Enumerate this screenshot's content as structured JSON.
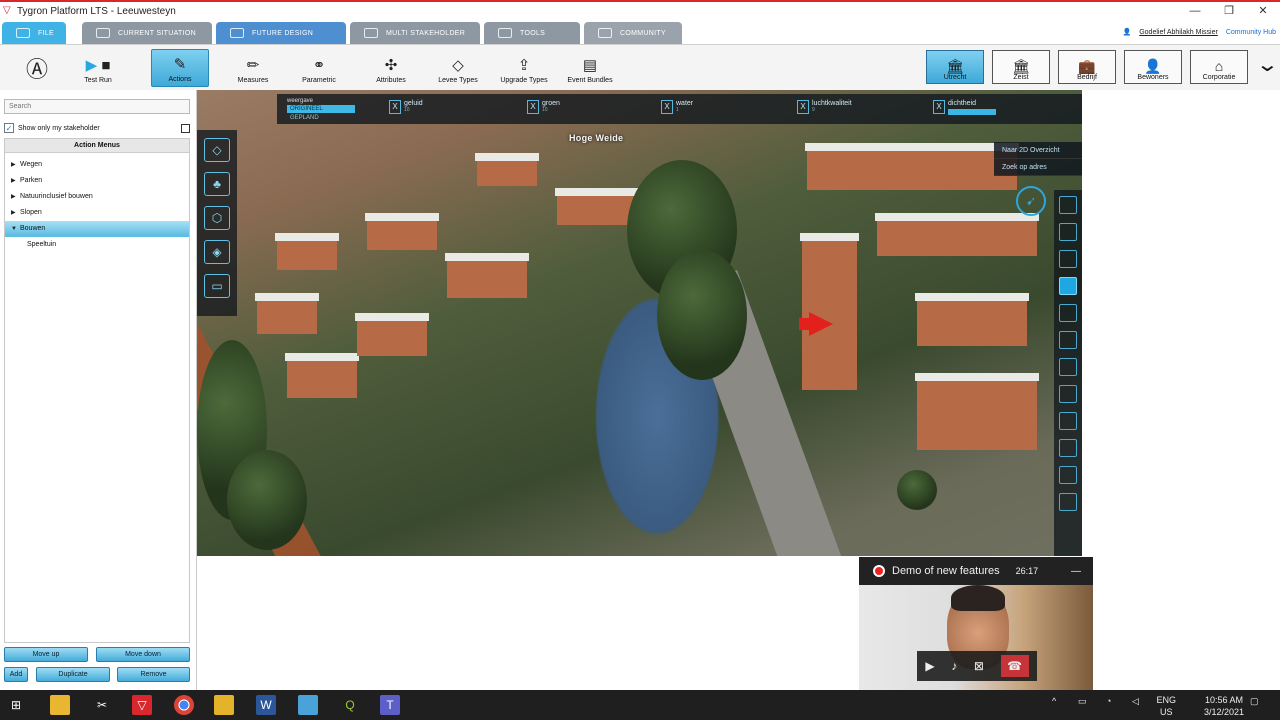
{
  "window": {
    "title": "Tygron Platform LTS - Leeuwesteyn"
  },
  "tabs": [
    {
      "label": "FILE",
      "color": "#40b3e6"
    },
    {
      "label": "CURRENT SITUATION",
      "color": "#8d98a3"
    },
    {
      "label": "FUTURE DESIGN",
      "color": "#4d8fd0"
    },
    {
      "label": "MULTI STAKEHOLDER",
      "color": "#8d98a3"
    },
    {
      "label": "TOOLS",
      "color": "#8d98a3"
    },
    {
      "label": "COMMUNITY",
      "color": "#9aa3ab"
    }
  ],
  "user": {
    "name": "Godelief Abhilakh Missier",
    "hub": "Community Hub"
  },
  "toolbar": {
    "test_run": "Test Run",
    "actions": "Actions",
    "measures": "Measures",
    "parametric": "Parametric",
    "attributes": "Attributes",
    "levee_types": "Levee Types",
    "upgrade_types": "Upgrade Types",
    "event_bundles": "Event Bundles"
  },
  "stakeholders": [
    "Utrecht",
    "Zeist",
    "Bedrijf",
    "Bewoners",
    "Corporatie"
  ],
  "sidebar": {
    "search_placeholder": "Search",
    "show_only": "Show only my stakeholder",
    "menu_header": "Action Menus",
    "items": [
      "Wegen",
      "Parken",
      "Natuurinclusief bouwen",
      "Slopen",
      "Bouwen"
    ],
    "sub_items": [
      "Speeltuin"
    ],
    "buttons": {
      "move_up": "Move up",
      "move_down": "Move down",
      "add": "Add",
      "duplicate": "Duplicate",
      "remove": "Remove"
    }
  },
  "view": {
    "place": "Hoge Weide",
    "weergave": {
      "label": "weergave",
      "options": [
        "ORIGINEEL",
        "GEPLAND"
      ]
    },
    "overlays": [
      {
        "name": "geluid",
        "sub": "10"
      },
      {
        "name": "groen",
        "sub": "10"
      },
      {
        "name": "water",
        "sub": "1"
      },
      {
        "name": "luchtkwaliteit",
        "sub": "9"
      },
      {
        "name": "dichtheid",
        "sub": "1"
      }
    ],
    "nav": {
      "overview": "Naar 2D Overzicht",
      "address": "Zoek op adres"
    }
  },
  "video": {
    "title": "Demo of new features",
    "time": "26:17"
  },
  "taskbar": {
    "lang1": "ENG",
    "lang2": "US",
    "time": "10:56 AM",
    "date": "3/12/2021"
  }
}
